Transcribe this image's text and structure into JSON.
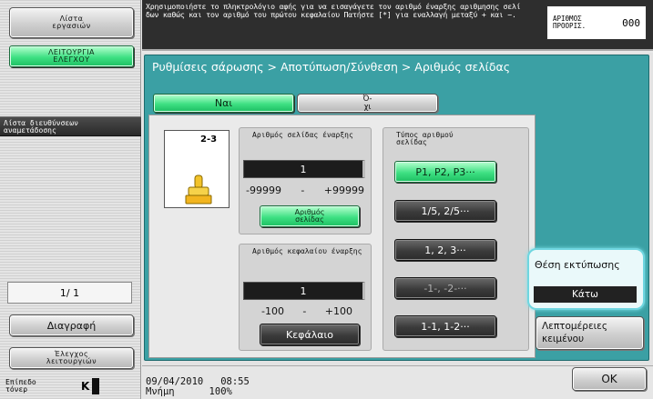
{
  "sidebar": {
    "job_list_label": "Λίστα εργασιών",
    "job_details_label": "ΛΕΙΤΟΥΡΓΙΑ ΕΛΕΓΧΟΥ",
    "address_list_label": "Λίστα διευθύνσεων αναμετάδοσης",
    "page_indicator": "1/ 1",
    "delete_label": "Διαγραφή",
    "check_job_label": "Έλεγχος λειτουργιών",
    "toner_label": "Επίπεδο τόνερ",
    "toner_color": "K"
  },
  "message": {
    "text": "Χρησιμοποιήστε το πληκτρολόγιο αφής για να εισαγάγετε τον αριθμό έναρξης αριθμησης σελί δων καθώς και τον αριθμό του πρώτου κεφαλαίου Πατήστε [*] για εναλλαγή μεταξύ + και −."
  },
  "copies": {
    "label": "ΑΡΙΘΜΟΣ ΠΡΟΟΡΙΣ.",
    "value": "000"
  },
  "breadcrumb": "Ρυθμίσεις σάρωσης > Αποτύπωση/Σύνθεση > Αριθμός σελίδας",
  "toggle": {
    "yes_label": "Ναι",
    "no_label": "Ό-χι"
  },
  "preview": {
    "sample_text": "2-3"
  },
  "page_start": {
    "title": "Αριθμός σελίδας έναρξης",
    "value": "1",
    "range_min": "-99999",
    "range_sep": "-",
    "range_max": "+99999",
    "button_label": "Αριθμός σελίδας"
  },
  "chapter_start": {
    "title": "Αριθμός κεφαλαίου έναρξης",
    "value": "1",
    "range_min": "-100",
    "range_sep": "-",
    "range_max": "+100",
    "button_label": "Κεφάλαιο"
  },
  "number_type": {
    "title": "Τύπος αριθμού σελίδας",
    "options": [
      "P1, P2, P3···",
      "1/5, 2/5···",
      "1, 2, 3···",
      "-1-, -2-···",
      "1-1, 1-2···"
    ]
  },
  "print_position": {
    "title": "Θέση εκτύπωσης",
    "value": "Κάτω"
  },
  "text_details_label": "Λεπτομέρειες κειμένου",
  "ok_label": "OK",
  "status": {
    "date": "09/04/2010",
    "time": "08:55",
    "memory_label": "Μνήμη",
    "memory_value": "100%"
  },
  "colors": {
    "panel_teal": "#3ba0a4",
    "green_button": "#3ee083",
    "highlight_cyan": "#6fd6e0"
  }
}
